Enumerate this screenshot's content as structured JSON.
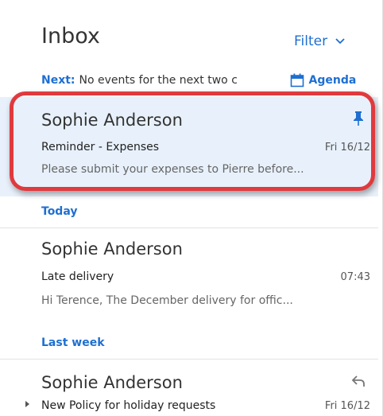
{
  "header": {
    "title": "Inbox",
    "filter_label": "Filter",
    "next_label": "Next:",
    "next_text": "No events for the next two c",
    "agenda_label": "Agenda",
    "accent_color": "#1e6fd1"
  },
  "messages": [
    {
      "sender": "Sophie Anderson",
      "subject": "Reminder - Expenses",
      "date": "Fri 16/12",
      "preview": "Please submit your expenses to Pierre before...",
      "pinned": true,
      "status_icon": "pin-icon",
      "highlighted": true
    },
    {
      "sender": "Sophie Anderson",
      "subject": "Late delivery",
      "date": "07:43",
      "preview": "Hi Terence,   The December delivery for offic..."
    },
    {
      "sender": "Sophie Anderson",
      "subject": "New Policy for holiday requests",
      "date": "Fri 16/12",
      "status_icon": "reply-icon"
    }
  ],
  "groups": {
    "today": "Today",
    "last_week": "Last week"
  },
  "highlight_color": "#e03a3e"
}
